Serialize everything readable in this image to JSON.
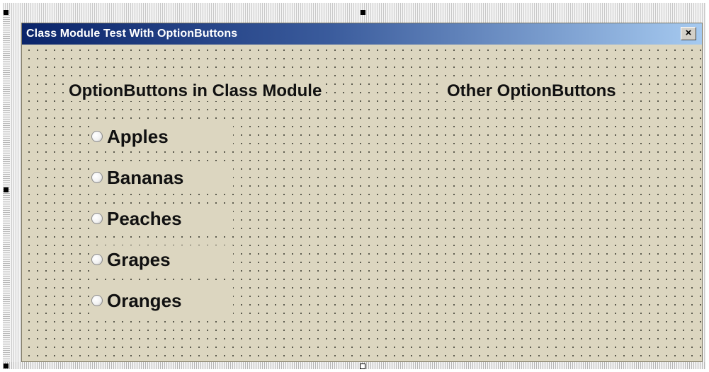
{
  "form": {
    "title": "Class Module Test With OptionButtons",
    "close_label": "×"
  },
  "headings": {
    "left": "OptionButtons in Class Module",
    "right": "Other OptionButtons"
  },
  "options": [
    {
      "label": "Apples",
      "selected": false
    },
    {
      "label": "Bananas",
      "selected": false
    },
    {
      "label": "Peaches",
      "selected": false
    },
    {
      "label": "Grapes",
      "selected": false
    },
    {
      "label": "Oranges",
      "selected": false
    }
  ],
  "icons": {
    "close": "close-icon",
    "radio": "radio-unchecked-icon"
  },
  "colors": {
    "form_background": "#dcd6c0",
    "titlebar_start": "#0a246a",
    "titlebar_end": "#a6caf0"
  }
}
